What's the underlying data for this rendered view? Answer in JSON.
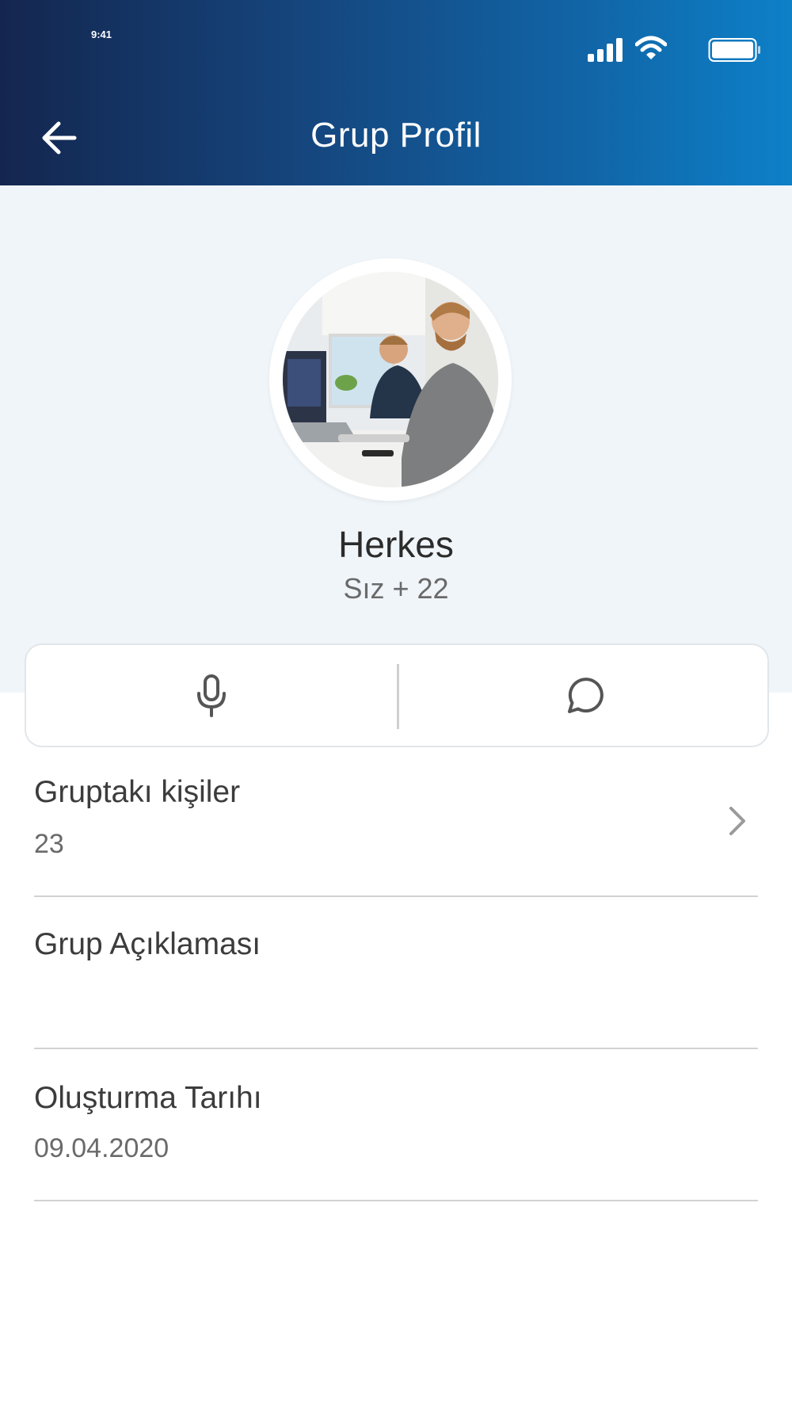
{
  "status_bar": {
    "time": "9:41",
    "icons": [
      "signal-icon",
      "wifi-icon",
      "battery-icon"
    ]
  },
  "header": {
    "back_icon": "arrow-left-icon",
    "title": "Grup Profil"
  },
  "profile": {
    "avatar_description": "group-photo",
    "name": "Herkes",
    "members_summary": "Sız + 22"
  },
  "actions": [
    {
      "icon": "microphone-icon"
    },
    {
      "icon": "chat-bubble-icon"
    }
  ],
  "details": {
    "members_label": "Gruptakı kişiler",
    "members_value": "23",
    "description_label": "Grup Açıklaması",
    "description_value": "",
    "created_label": "Oluşturma Tarıhı",
    "created_value": "09.04.2020"
  },
  "colors": {
    "header_start": "#14264f",
    "header_end": "#0d80c8",
    "profile_bg": "#f0f5f9",
    "icon_gray": "#555555"
  }
}
